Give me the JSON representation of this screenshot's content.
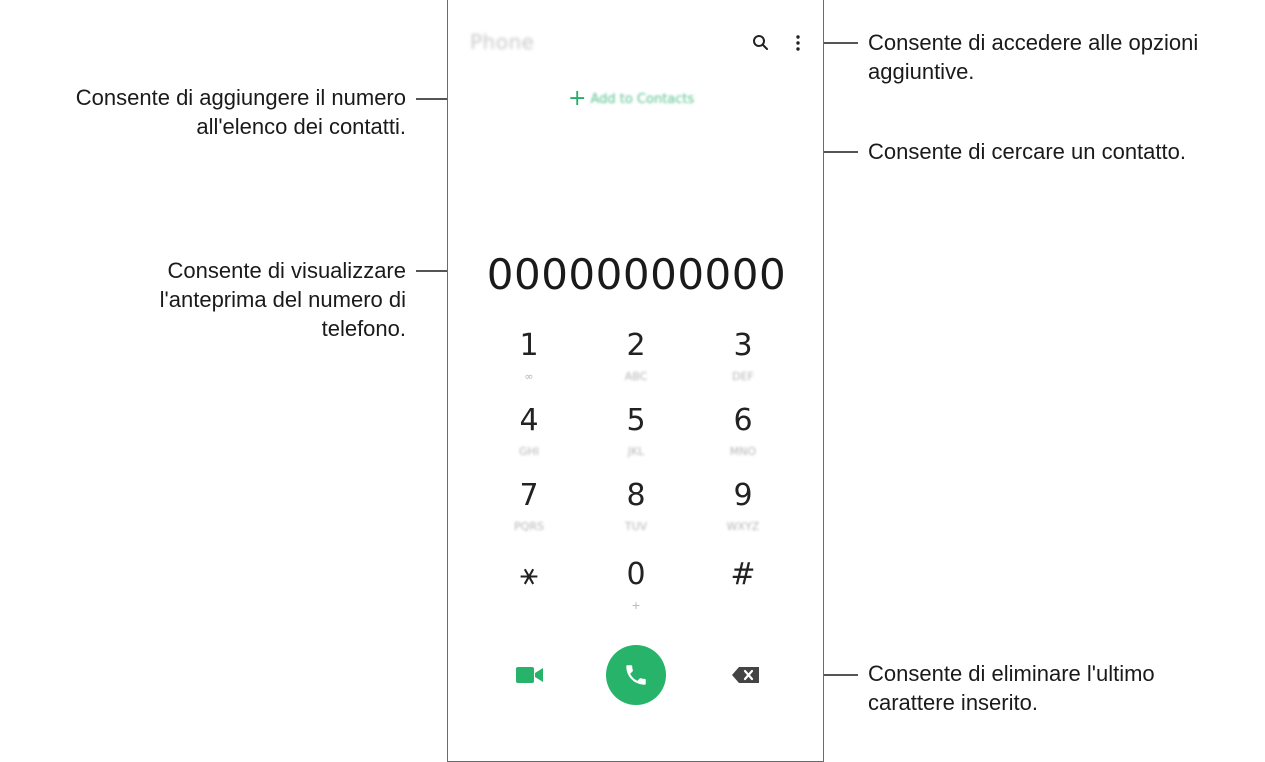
{
  "phone": {
    "app_title": "Phone",
    "add_contact_label": "Add to Contacts",
    "number": "00000000000",
    "keys": [
      {
        "digit": "1",
        "sub": "∞",
        "blur": false
      },
      {
        "digit": "2",
        "sub": "ABC",
        "blur": true
      },
      {
        "digit": "3",
        "sub": "DEF",
        "blur": true
      },
      {
        "digit": "4",
        "sub": "GHI",
        "blur": true
      },
      {
        "digit": "5",
        "sub": "JKL",
        "blur": true
      },
      {
        "digit": "6",
        "sub": "MNO",
        "blur": true
      },
      {
        "digit": "7",
        "sub": "PQRS",
        "blur": true
      },
      {
        "digit": "8",
        "sub": "TUV",
        "blur": true
      },
      {
        "digit": "9",
        "sub": "WXYZ",
        "blur": true
      },
      {
        "digit": "⚹",
        "sub": "",
        "blur": false
      },
      {
        "digit": "0",
        "sub": "+",
        "blur": false
      },
      {
        "digit": "#",
        "sub": "",
        "blur": false
      }
    ],
    "accent_color": "#27b36a"
  },
  "annotations": {
    "add_contact": [
      "Consente di aggiungere il numero",
      "all'elenco dei contatti."
    ],
    "preview": [
      "Consente di visualizzare",
      "l'anteprima del numero di",
      "telefono."
    ],
    "options": [
      "Consente di accedere alle opzioni",
      "aggiuntive."
    ],
    "search": [
      "Consente di cercare un contatto."
    ],
    "delete": [
      "Consente di eliminare l'ultimo",
      "carattere inserito."
    ]
  },
  "icons": {
    "search": "search-icon",
    "more": "more-options-icon",
    "video": "video-call-icon",
    "call": "phone-call-icon",
    "delete": "backspace-icon"
  }
}
